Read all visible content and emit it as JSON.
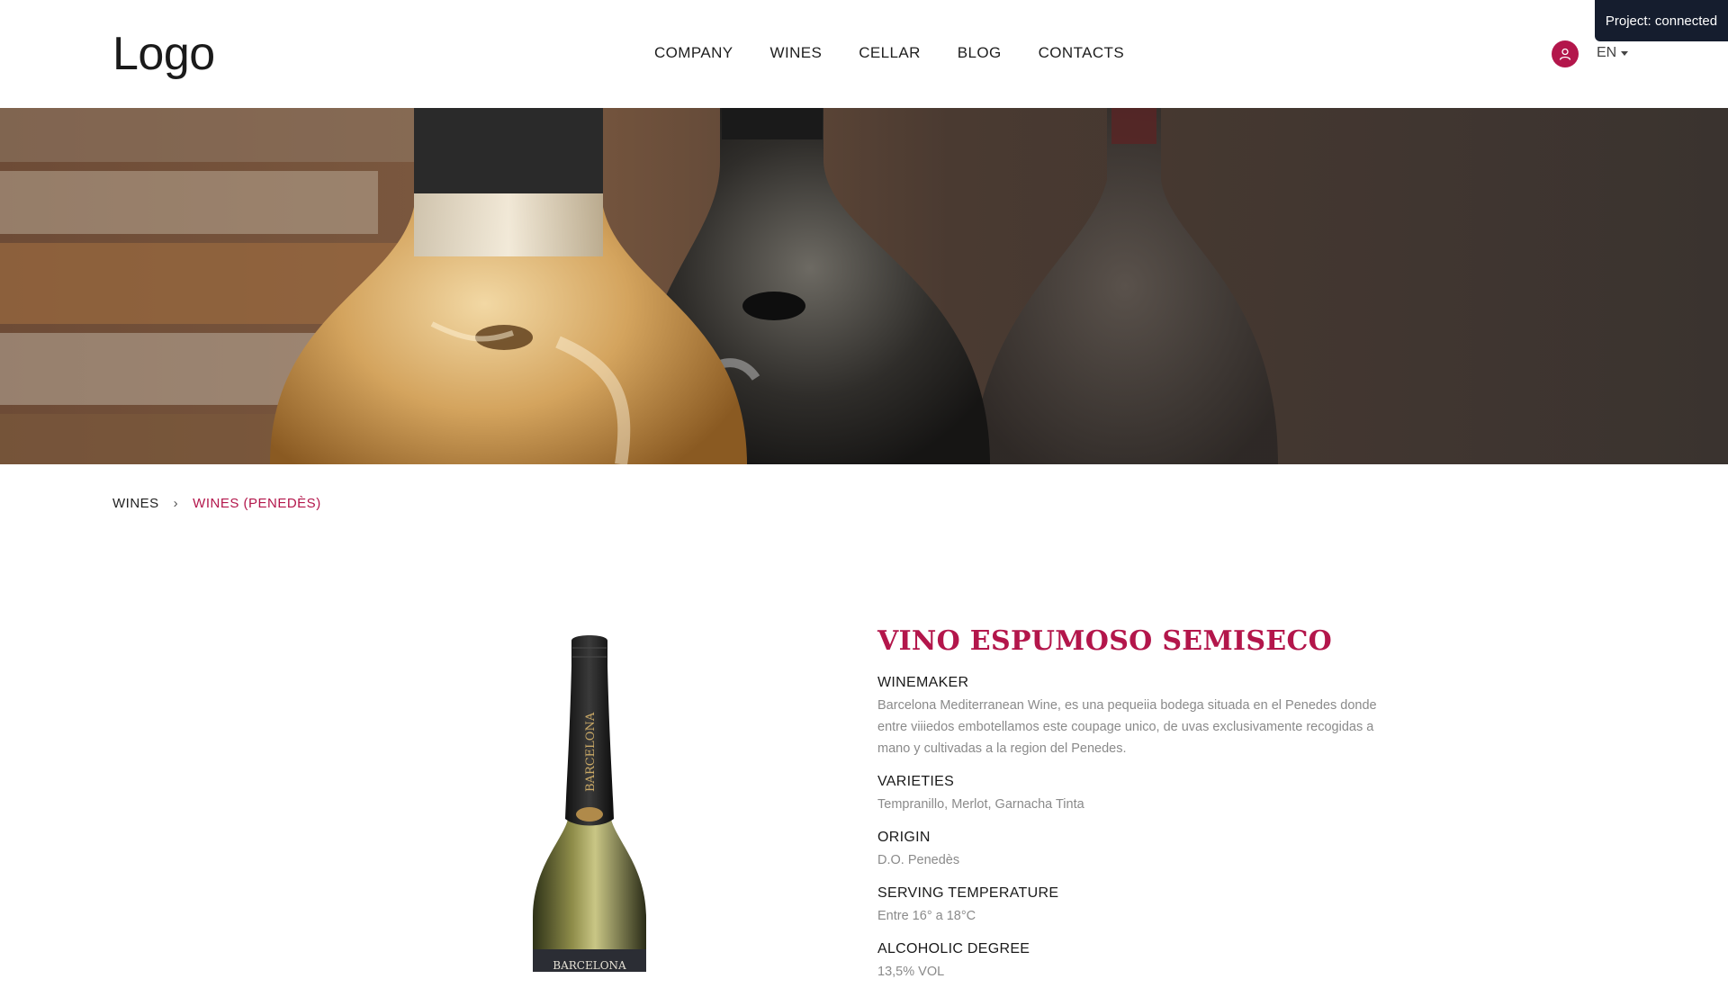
{
  "header": {
    "logo": "Logo",
    "nav": [
      "COMPANY",
      "WINES",
      "CELLAR",
      "BLOG",
      "CONTACTS"
    ],
    "language": "EN",
    "status": "Project: connected"
  },
  "icons": {
    "user": "user-icon",
    "dropdown": "caret-down-icon",
    "breadcrumb_separator": "chevron-right-icon"
  },
  "breadcrumb": {
    "items": [
      "WINES",
      "WINES (PENEDÈS)"
    ],
    "separator": "›"
  },
  "product": {
    "title": "VINO ESPUMOSO SEMISECO",
    "sections": [
      {
        "label": "WINEMAKER",
        "value": "Barcelona Mediterranean Wine, es una pequeiia bodega situada en el Penedes donde entre viiiedos embotellamos este coupage unico, de uvas exclusivamente recogidas a mano y cultivadas a la region del Penedes."
      },
      {
        "label": "VARIETIES",
        "value": "Tempranillo, Merlot, Garnacha Tinta"
      },
      {
        "label": "ORIGIN",
        "value": "D.O. Penedès"
      },
      {
        "label": "SERVING TEMPERATURE",
        "value": "Entre 16° a 18°C"
      },
      {
        "label": "ALCOHOLIC DEGREE",
        "value": "13,5% VOL"
      }
    ],
    "bottle_label_top": "BARCELONA",
    "bottle_label_bottom": "BARCELONA"
  },
  "colors": {
    "accent": "#b3164b",
    "status_bg": "#151d2e"
  }
}
